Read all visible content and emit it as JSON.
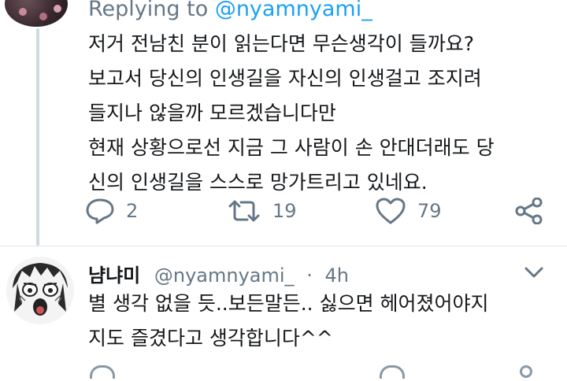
{
  "tweet1": {
    "replying_prefix": "Replying to",
    "replying_handle": "@nyamnyami_",
    "lines": [
      "저거 전남친 분이 읽는다면 무슨생각이 들까요?",
      "보고서 당신의 인생길을 자신의 인생걸고 조지려",
      "들지나 않을까 모르겠습니다만",
      "현재 상황으로선 지금 그 사람이 손 안대더래도 당",
      "신의 인생길을 스스로 망가트리고 있네요."
    ],
    "reply_count": "2",
    "retweet_count": "19",
    "like_count": "79"
  },
  "tweet2": {
    "display_name": "냠냐미",
    "handle": "@nyamnyami_",
    "separator": "·",
    "time": "4h",
    "lines": [
      "별 생각 없을 듯..보든말든.. 싫으면 헤어졌어야지",
      "지도 즐겼다고 생각합니다^^"
    ]
  },
  "colors": {
    "secondary_text": "#657786",
    "link": "#1da1f2",
    "primary_text": "#14171a",
    "thread_line": "#cfd9de"
  },
  "icons": [
    "reply-icon",
    "retweet-icon",
    "like-icon",
    "share-icon",
    "chevron-down-icon"
  ]
}
